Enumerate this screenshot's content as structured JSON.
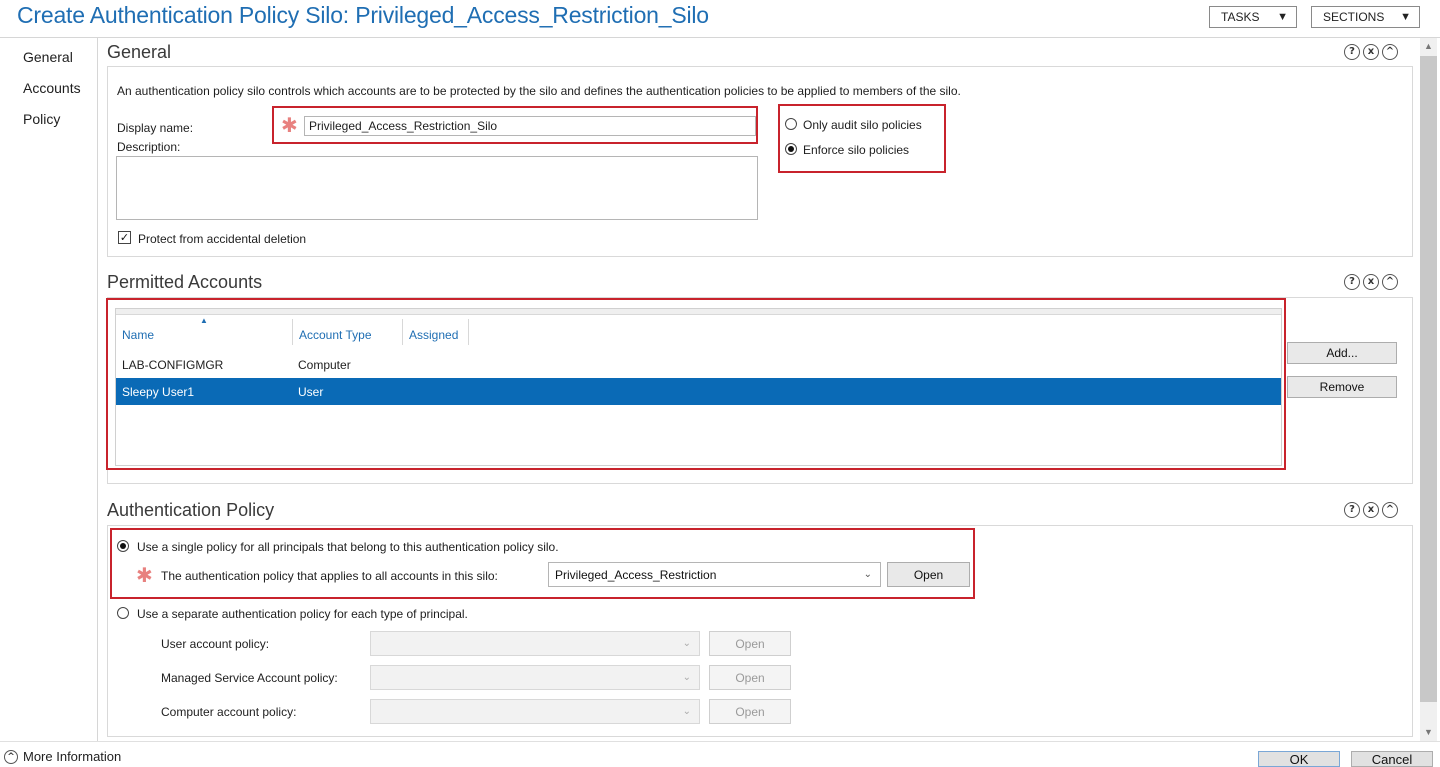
{
  "header": {
    "title": "Create Authentication Policy Silo: Privileged_Access_Restriction_Silo",
    "tasks_label": "TASKS",
    "sections_label": "SECTIONS"
  },
  "nav": {
    "items": [
      "General",
      "Accounts",
      "Policy"
    ]
  },
  "section_controls": {
    "help": "?",
    "close": "x",
    "collapse": "^"
  },
  "general": {
    "title": "General",
    "description_text": "An authentication policy silo controls which accounts are to be protected by the silo and defines the authentication policies to be applied to members of the silo.",
    "display_name_label": "Display name:",
    "display_name_value": "Privileged_Access_Restriction_Silo",
    "description_label": "Description:",
    "description_value": "",
    "radio_audit_label": "Only audit silo policies",
    "radio_enforce_label": "Enforce silo policies",
    "enforce_selected": true,
    "protect_label": "Protect from accidental deletion",
    "protect_checked": true
  },
  "permitted_accounts": {
    "title": "Permitted Accounts",
    "columns": [
      "Name",
      "Account Type",
      "Assigned"
    ],
    "rows": [
      {
        "name": "LAB-CONFIGMGR",
        "type": "Computer",
        "assigned": ""
      },
      {
        "name": "Sleepy User1",
        "type": "User",
        "assigned": ""
      }
    ],
    "selected_row": 1,
    "add_label": "Add...",
    "remove_label": "Remove"
  },
  "auth_policy": {
    "title": "Authentication Policy",
    "single_policy_label": "Use a single policy for all principals that belong to this authentication policy silo.",
    "single_selected": true,
    "applies_label": "The authentication policy that applies to all accounts in this silo:",
    "policy_value": "Privileged_Access_Restriction",
    "open_label": "Open",
    "separate_label": "Use a separate authentication policy for each type of principal.",
    "user_policy_label": "User account policy:",
    "msa_policy_label": "Managed Service Account policy:",
    "computer_policy_label": "Computer account policy:",
    "disabled_open_label": "Open"
  },
  "footer": {
    "more_info_label": "More Information",
    "ok_label": "OK",
    "cancel_label": "Cancel"
  },
  "colors": {
    "accent": "#1f6eb3",
    "highlight_box": "#c8232c",
    "selected_row": "#0a6ab6"
  }
}
